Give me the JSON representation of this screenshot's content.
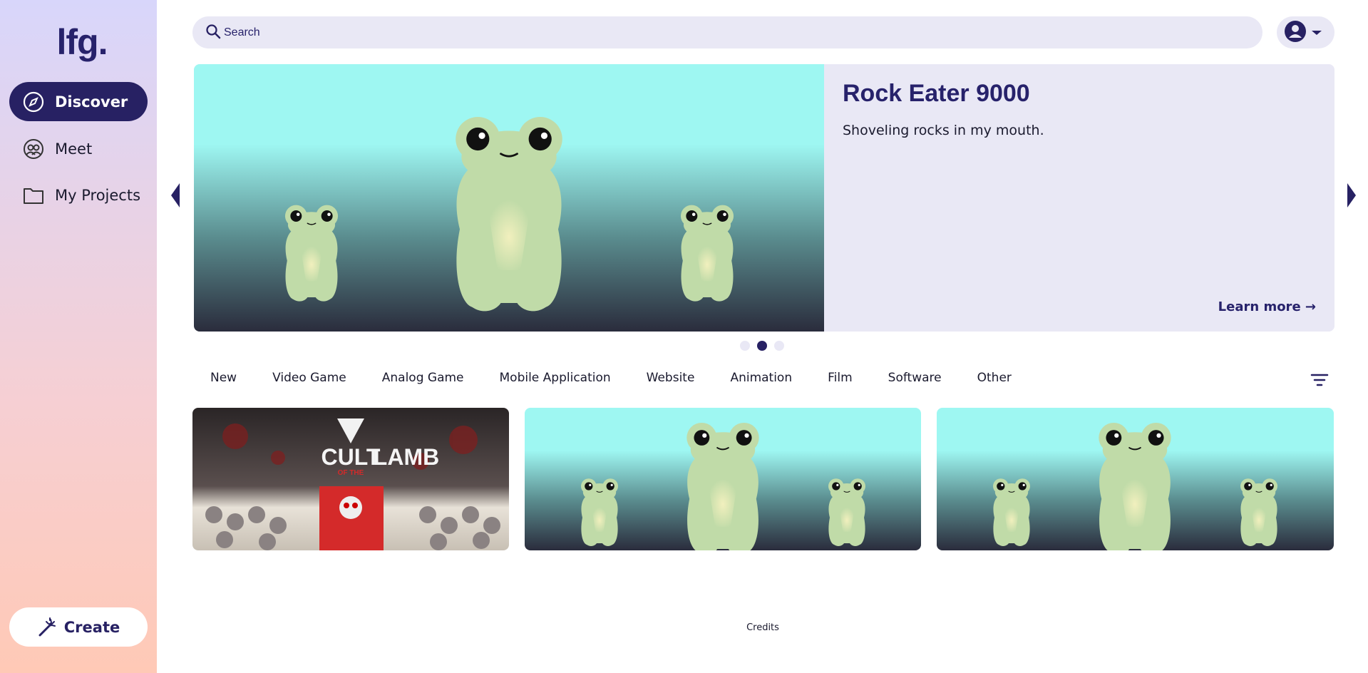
{
  "sidebar": {
    "logo": "lfg.",
    "items": [
      {
        "label": "Discover",
        "icon": "compass-icon",
        "active": true
      },
      {
        "label": "Meet",
        "icon": "people-icon",
        "active": false
      },
      {
        "label": "My Projects",
        "icon": "folder-icon",
        "active": false
      }
    ],
    "create_label": "Create",
    "create_icon": "magic-wand-icon"
  },
  "header": {
    "search_placeholder": "Search",
    "search_icon": "search-icon",
    "user_icon": "user-avatar-icon",
    "dropdown_icon": "caret-down-icon"
  },
  "hero": {
    "title": "Rock Eater 9000",
    "description": "Shoveling rocks in my mouth.",
    "learn_more": "Learn more →",
    "slides_total": 3,
    "active_slide": 2
  },
  "categories": [
    "New",
    "Video Game",
    "Analog Game",
    "Mobile Application",
    "Website",
    "Animation",
    "Film",
    "Software",
    "Other"
  ],
  "filter_icon": "filter-icon",
  "cards": [
    {
      "image": "cult-of-the-lamb",
      "logo_text_1": "CULT",
      "logo_text_2": "OF THE",
      "logo_text_3": "LAMB"
    },
    {
      "image": "frogs"
    },
    {
      "image": "frogs"
    }
  ],
  "footer": {
    "credits": "Credits"
  },
  "colors": {
    "accent": "#272163",
    "panel": "#e9e8f5",
    "frog": "#c0dba8",
    "sky": "#9ef5f0"
  }
}
